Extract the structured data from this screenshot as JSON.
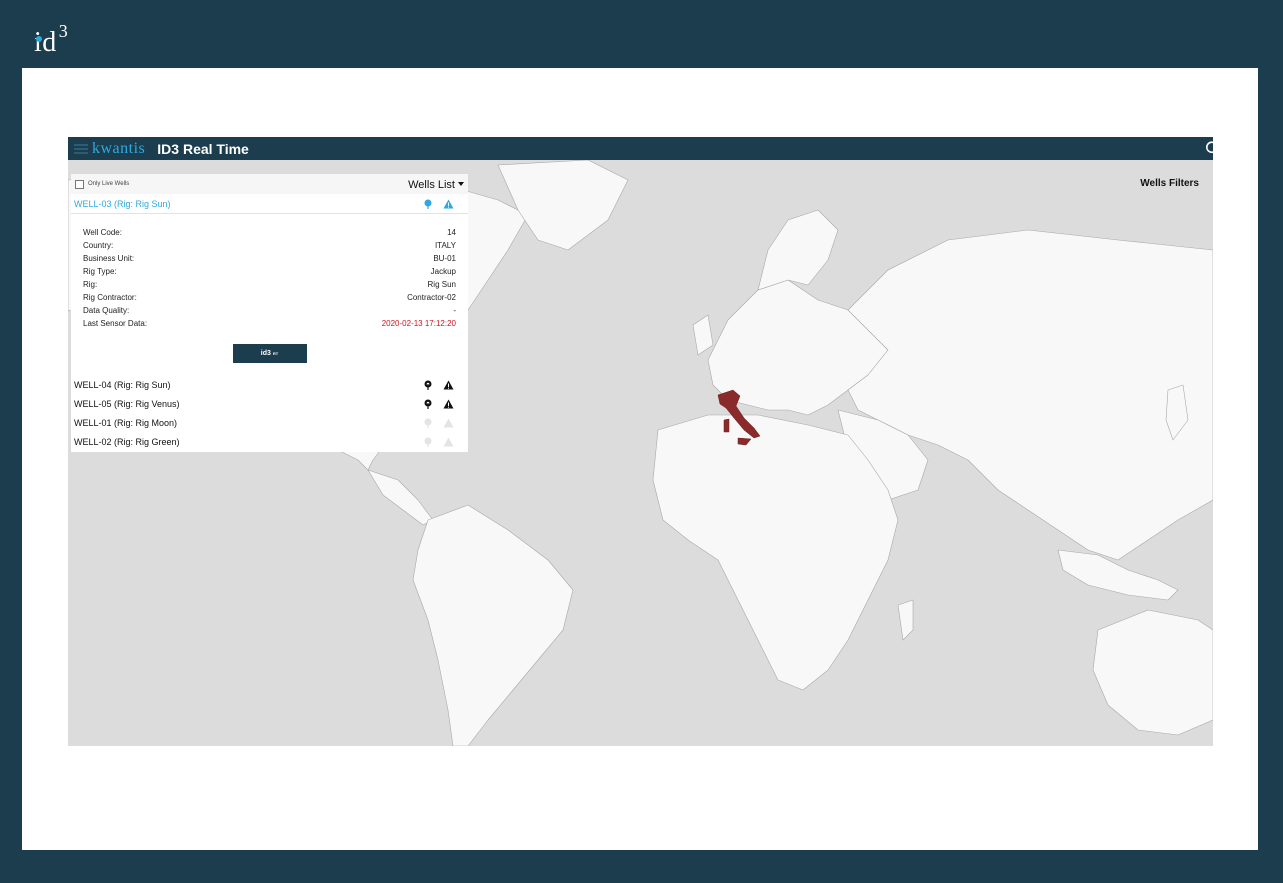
{
  "brand": {
    "name": "id",
    "sup": "3"
  },
  "app": {
    "logo": "kwantis",
    "title": "ID3 Real Time"
  },
  "map": {
    "highlighted_country": "Italy",
    "colors": {
      "ocean": "#dcdcdc",
      "land": "#f8f8f8",
      "border": "#999999",
      "highlight": "#8b2a2a"
    }
  },
  "filters": {
    "title": "Wells Filters"
  },
  "panel": {
    "live_only_label": "Only Live Wells",
    "list_title": "Wells List",
    "selected_well": "WELL-03 (Rig: Rig Sun)",
    "details": [
      {
        "label": "Well Code:",
        "value": "14"
      },
      {
        "label": "Country:",
        "value": "ITALY"
      },
      {
        "label": "Business Unit:",
        "value": "BU-01"
      },
      {
        "label": "Rig Type:",
        "value": "Jackup"
      },
      {
        "label": "Rig:",
        "value": "Rig Sun"
      },
      {
        "label": "Rig Contractor:",
        "value": "Contractor-02"
      },
      {
        "label": "Data Quality:",
        "value": "-"
      },
      {
        "label": "Last Sensor Data:",
        "value": "2020-02-13 17:12:20"
      }
    ],
    "button": {
      "label": "id3",
      "sub": "RT"
    },
    "wells": [
      {
        "label": "WELL-04 (Rig: Rig Sun)",
        "status": "dark"
      },
      {
        "label": "WELL-05 (Rig: Rig Venus)",
        "status": "dark"
      },
      {
        "label": "WELL-01 (Rig: Rig Moon)",
        "status": "faded"
      },
      {
        "label": "WELL-02 (Rig: Rig Green)",
        "status": "faded"
      }
    ]
  }
}
